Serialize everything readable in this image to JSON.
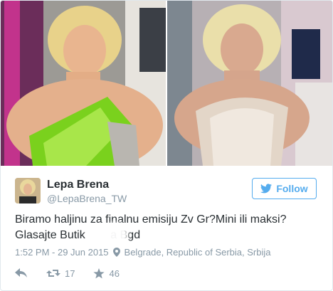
{
  "tweet": {
    "author_name": "Lepa Brena",
    "author_handle": "@LepaBrena_TW",
    "follow_label": "Follow",
    "text_line1": "Biramo haljinu za finalnu emisiju Zv Gr?Mini ili maksi?",
    "text_line2": "Glasajte Butik        a Bgd",
    "timestamp": "1:52 PM - 29 Jun 2015",
    "location": "Belgrade, Republic of Serbia, Srbija",
    "retweet_count": "17",
    "like_count": "46"
  },
  "icons": {
    "follow": "twitter-bird-icon",
    "location": "location-pin-icon",
    "reply": "reply-icon",
    "retweet": "retweet-icon",
    "like": "star-icon"
  },
  "colors": {
    "accent": "#55acee",
    "text": "#292f33",
    "muted": "#8899a6",
    "green_dress": "#7ad11d",
    "silver_dress": "#e3d6c8"
  }
}
